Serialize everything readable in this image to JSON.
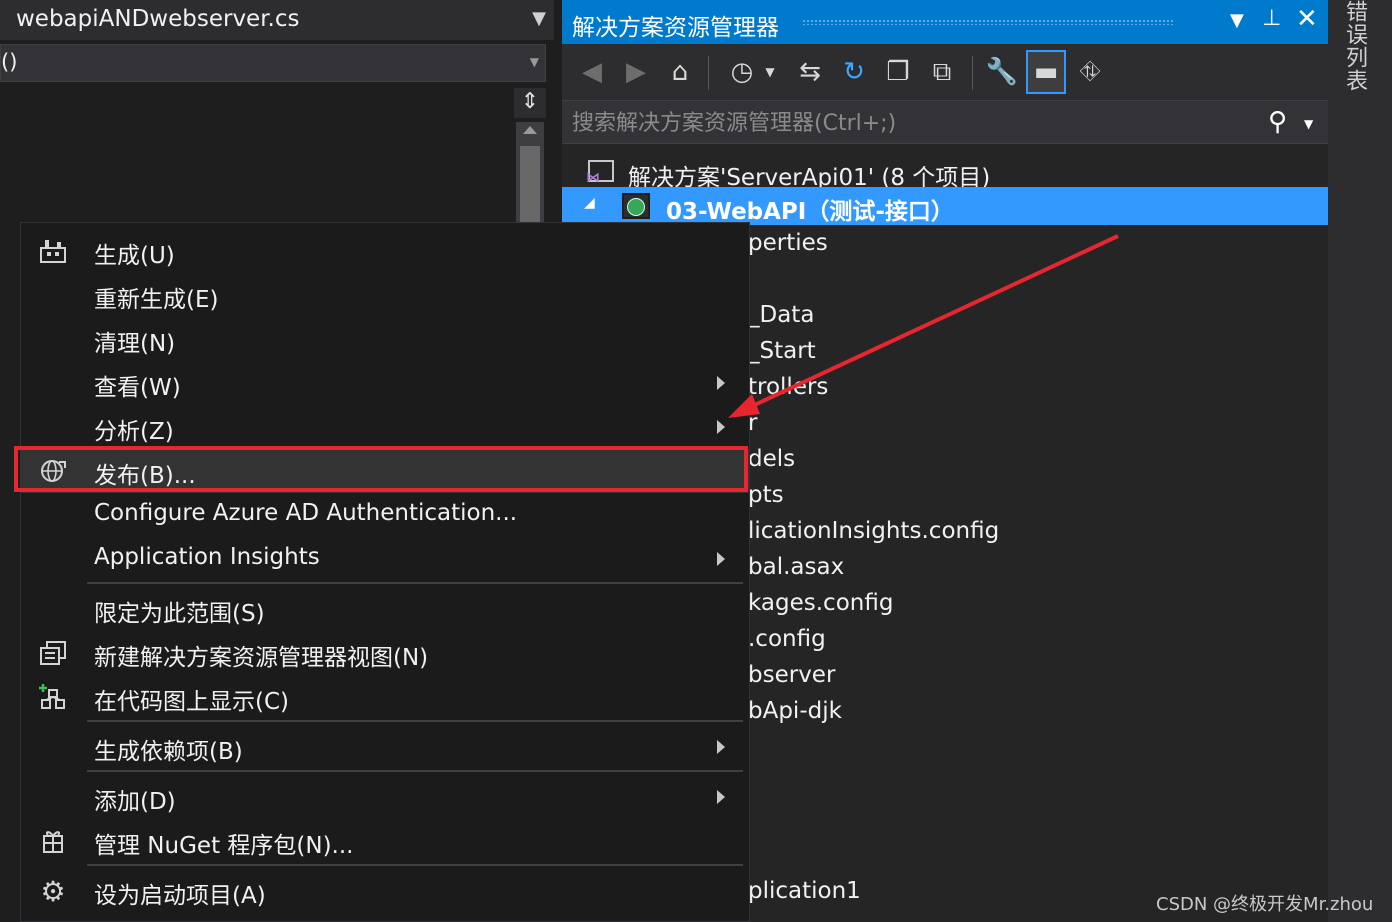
{
  "editor": {
    "tab_title": "webapiANDwebserver.cs",
    "nav_value": "()"
  },
  "solution_explorer": {
    "title": "解决方案资源管理器",
    "search_placeholder": "搜索解决方案资源管理器(Ctrl+;)",
    "solution_label": "解决方案'ServerApi01' (8 个项目)",
    "project_label": "03-WebAPI（测试-接口）",
    "partial_items": [
      "perties",
      "_Data",
      "_Start",
      "trollers",
      "r",
      "dels",
      "pts",
      "licationInsights.config",
      "bal.asax",
      "kages.config",
      ".config",
      "bserver",
      "bApi-djk",
      "plication1"
    ]
  },
  "side_tab": "错误列表",
  "context_menu": {
    "items": [
      {
        "label": "生成(U)",
        "icon": "build-icon",
        "submenu": false
      },
      {
        "label": "重新生成(E)",
        "icon": "",
        "submenu": false
      },
      {
        "label": "清理(N)",
        "icon": "",
        "submenu": false
      },
      {
        "label": "查看(W)",
        "icon": "",
        "submenu": true
      },
      {
        "label": "分析(Z)",
        "icon": "",
        "submenu": true
      },
      {
        "label": "发布(B)...",
        "icon": "publish-globe-icon",
        "submenu": false
      },
      {
        "label": "Configure Azure AD Authentication...",
        "icon": "",
        "submenu": false
      },
      {
        "label": "Application Insights",
        "icon": "",
        "submenu": true
      },
      {
        "label": "限定为此范围(S)",
        "icon": "",
        "submenu": false
      },
      {
        "label": "新建解决方案资源管理器视图(N)",
        "icon": "new-view-icon",
        "submenu": false
      },
      {
        "label": "在代码图上显示(C)",
        "icon": "code-map-icon",
        "submenu": false
      },
      {
        "label": "生成依赖项(B)",
        "icon": "",
        "submenu": true
      },
      {
        "label": "添加(D)",
        "icon": "",
        "submenu": true
      },
      {
        "label": "管理 NuGet 程序包(N)...",
        "icon": "nuget-package-icon",
        "submenu": false
      },
      {
        "label": "设为启动项目(A)",
        "icon": "gear-icon",
        "submenu": false
      }
    ]
  },
  "annotation": {
    "highlight_color": "#e8262f"
  },
  "watermark": "CSDN @终极开发Mr.zhou",
  "colors": {
    "accent": "#007acc",
    "selection": "#3399ff",
    "background": "#1e1e1e"
  }
}
